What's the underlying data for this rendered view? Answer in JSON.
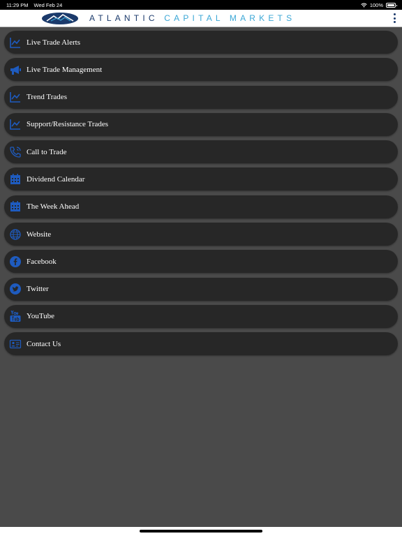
{
  "status": {
    "time": "11:29 PM",
    "date": "Wed Feb 24",
    "battery": "100%"
  },
  "header": {
    "logo_word1": "ATLANTIC",
    "logo_word2": "CAPITAL MARKETS"
  },
  "colors": {
    "accent": "#1e5bbf",
    "item_bg": "#272727",
    "page_bg": "#4a4a4a"
  },
  "menu": [
    {
      "label": "Live Trade Alerts",
      "icon": "chart-line-icon"
    },
    {
      "label": "Live Trade Management",
      "icon": "megaphone-icon"
    },
    {
      "label": "Trend Trades",
      "icon": "chart-line-icon"
    },
    {
      "label": "Support/Resistance Trades",
      "icon": "chart-line-icon"
    },
    {
      "label": "Call to Trade",
      "icon": "phone-icon"
    },
    {
      "label": "Dividend Calendar",
      "icon": "calendar-icon"
    },
    {
      "label": "The Week Ahead",
      "icon": "calendar-icon"
    },
    {
      "label": "Website",
      "icon": "globe-icon"
    },
    {
      "label": "Facebook",
      "icon": "facebook-icon"
    },
    {
      "label": "Twitter",
      "icon": "twitter-icon"
    },
    {
      "label": "YouTube",
      "icon": "youtube-icon"
    },
    {
      "label": "Contact Us",
      "icon": "contact-card-icon"
    }
  ]
}
